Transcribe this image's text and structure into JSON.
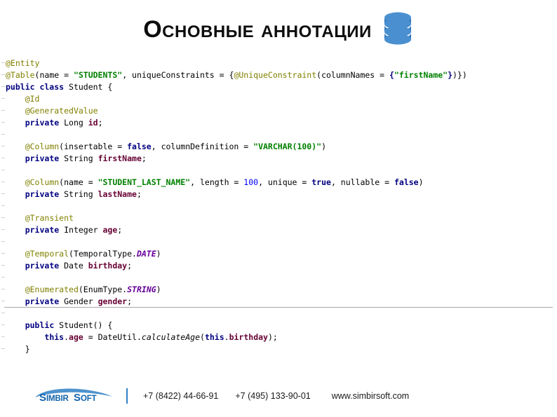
{
  "slide": {
    "title": "Основные аннотации",
    "title_icon": "database-icon"
  },
  "code": {
    "language": "java",
    "lines": [
      {
        "indent": 0,
        "tokens": [
          {
            "t": "@Entity",
            "c": "ann"
          }
        ]
      },
      {
        "indent": 0,
        "tokens": [
          {
            "t": "@Table",
            "c": "ann"
          },
          {
            "t": "(name = ",
            "c": "plain"
          },
          {
            "t": "\"STUDENTS\"",
            "c": "str"
          },
          {
            "t": ", uniqueConstraints = {",
            "c": "plain"
          },
          {
            "t": "@UniqueConstraint",
            "c": "ann"
          },
          {
            "t": "(columnNames = ",
            "c": "plain"
          },
          {
            "t": "{",
            "c": "kw"
          },
          {
            "t": "\"firstName\"",
            "c": "str"
          },
          {
            "t": "}",
            "c": "kw"
          },
          {
            "t": ")})",
            "c": "plain"
          }
        ]
      },
      {
        "indent": 0,
        "tokens": [
          {
            "t": "public class",
            "c": "kw"
          },
          {
            "t": " Student {",
            "c": "plain"
          }
        ]
      },
      {
        "indent": 1,
        "tokens": [
          {
            "t": "@Id",
            "c": "ann"
          }
        ]
      },
      {
        "indent": 1,
        "tokens": [
          {
            "t": "@GeneratedValue",
            "c": "ann"
          }
        ]
      },
      {
        "indent": 1,
        "tokens": [
          {
            "t": "private",
            "c": "kw"
          },
          {
            "t": " Long ",
            "c": "plain"
          },
          {
            "t": "id",
            "c": "fld"
          },
          {
            "t": ";",
            "c": "plain"
          }
        ]
      },
      {
        "indent": 0,
        "tokens": []
      },
      {
        "indent": 1,
        "tokens": [
          {
            "t": "@Column",
            "c": "ann"
          },
          {
            "t": "(insertable = ",
            "c": "plain"
          },
          {
            "t": "false",
            "c": "kw"
          },
          {
            "t": ", columnDefinition = ",
            "c": "plain"
          },
          {
            "t": "\"VARCHAR(100)\"",
            "c": "str"
          },
          {
            "t": ")",
            "c": "plain"
          }
        ]
      },
      {
        "indent": 1,
        "tokens": [
          {
            "t": "private",
            "c": "kw"
          },
          {
            "t": " String ",
            "c": "plain"
          },
          {
            "t": "firstName",
            "c": "fld"
          },
          {
            "t": ";",
            "c": "plain"
          }
        ]
      },
      {
        "indent": 0,
        "tokens": []
      },
      {
        "indent": 1,
        "tokens": [
          {
            "t": "@Column",
            "c": "ann"
          },
          {
            "t": "(name = ",
            "c": "plain"
          },
          {
            "t": "\"STUDENT_LAST_NAME\"",
            "c": "str"
          },
          {
            "t": ", length = ",
            "c": "plain"
          },
          {
            "t": "100",
            "c": "num"
          },
          {
            "t": ", unique = ",
            "c": "plain"
          },
          {
            "t": "true",
            "c": "kw"
          },
          {
            "t": ", nullable = ",
            "c": "plain"
          },
          {
            "t": "false",
            "c": "kw"
          },
          {
            "t": ")",
            "c": "plain"
          }
        ]
      },
      {
        "indent": 1,
        "tokens": [
          {
            "t": "private",
            "c": "kw"
          },
          {
            "t": " String ",
            "c": "plain"
          },
          {
            "t": "lastName",
            "c": "fld"
          },
          {
            "t": ";",
            "c": "plain"
          }
        ]
      },
      {
        "indent": 0,
        "tokens": []
      },
      {
        "indent": 1,
        "tokens": [
          {
            "t": "@Transient",
            "c": "ann"
          }
        ]
      },
      {
        "indent": 1,
        "tokens": [
          {
            "t": "private",
            "c": "kw"
          },
          {
            "t": " Integer ",
            "c": "plain"
          },
          {
            "t": "age",
            "c": "fld"
          },
          {
            "t": ";",
            "c": "plain"
          }
        ]
      },
      {
        "indent": 0,
        "tokens": []
      },
      {
        "indent": 1,
        "tokens": [
          {
            "t": "@Temporal",
            "c": "ann"
          },
          {
            "t": "(TemporalType.",
            "c": "plain"
          },
          {
            "t": "DATE",
            "c": "const"
          },
          {
            "t": ")",
            "c": "plain"
          }
        ]
      },
      {
        "indent": 1,
        "tokens": [
          {
            "t": "private",
            "c": "kw"
          },
          {
            "t": " Date ",
            "c": "plain"
          },
          {
            "t": "birthday",
            "c": "fld"
          },
          {
            "t": ";",
            "c": "plain"
          }
        ]
      },
      {
        "indent": 0,
        "tokens": []
      },
      {
        "indent": 1,
        "tokens": [
          {
            "t": "@Enumerated",
            "c": "ann"
          },
          {
            "t": "(EnumType.",
            "c": "plain"
          },
          {
            "t": "STRING",
            "c": "const"
          },
          {
            "t": ")",
            "c": "plain"
          }
        ]
      },
      {
        "indent": 1,
        "tokens": [
          {
            "t": "private",
            "c": "kw"
          },
          {
            "t": " Gender ",
            "c": "plain"
          },
          {
            "t": "gender",
            "c": "fld"
          },
          {
            "t": ";",
            "c": "plain"
          }
        ]
      },
      {
        "indent": 0,
        "tokens": [],
        "rule": true
      },
      {
        "indent": 1,
        "tokens": [
          {
            "t": "public",
            "c": "kw"
          },
          {
            "t": " Student() {",
            "c": "plain"
          }
        ]
      },
      {
        "indent": 2,
        "tokens": [
          {
            "t": "this",
            "c": "kw"
          },
          {
            "t": ".",
            "c": "plain"
          },
          {
            "t": "age",
            "c": "fld"
          },
          {
            "t": " = DateUtil.",
            "c": "plain"
          },
          {
            "t": "calculateAge",
            "c": "meth"
          },
          {
            "t": "(",
            "c": "plain"
          },
          {
            "t": "this",
            "c": "kw"
          },
          {
            "t": ".",
            "c": "plain"
          },
          {
            "t": "birthday",
            "c": "fld"
          },
          {
            "t": ");",
            "c": "plain"
          }
        ]
      },
      {
        "indent": 1,
        "tokens": [
          {
            "t": "}",
            "c": "plain"
          }
        ]
      }
    ]
  },
  "footer": {
    "logo_text": "SIMBIRSOFT",
    "logo_icon": "simbirsoft-logo",
    "phone_1": "+7 (8422) 44-66-91",
    "phone_2": "+7 (495) 133-90-01",
    "website": "www.simbirsoft.com"
  },
  "colors": {
    "annotation": "#808000",
    "keyword": "#000080",
    "string": "#008000",
    "field": "#660033",
    "number": "#0000ff",
    "constant": "#660099",
    "brand_blue": "#2f7fc4",
    "db_icon_blue": "#3b82c4"
  }
}
